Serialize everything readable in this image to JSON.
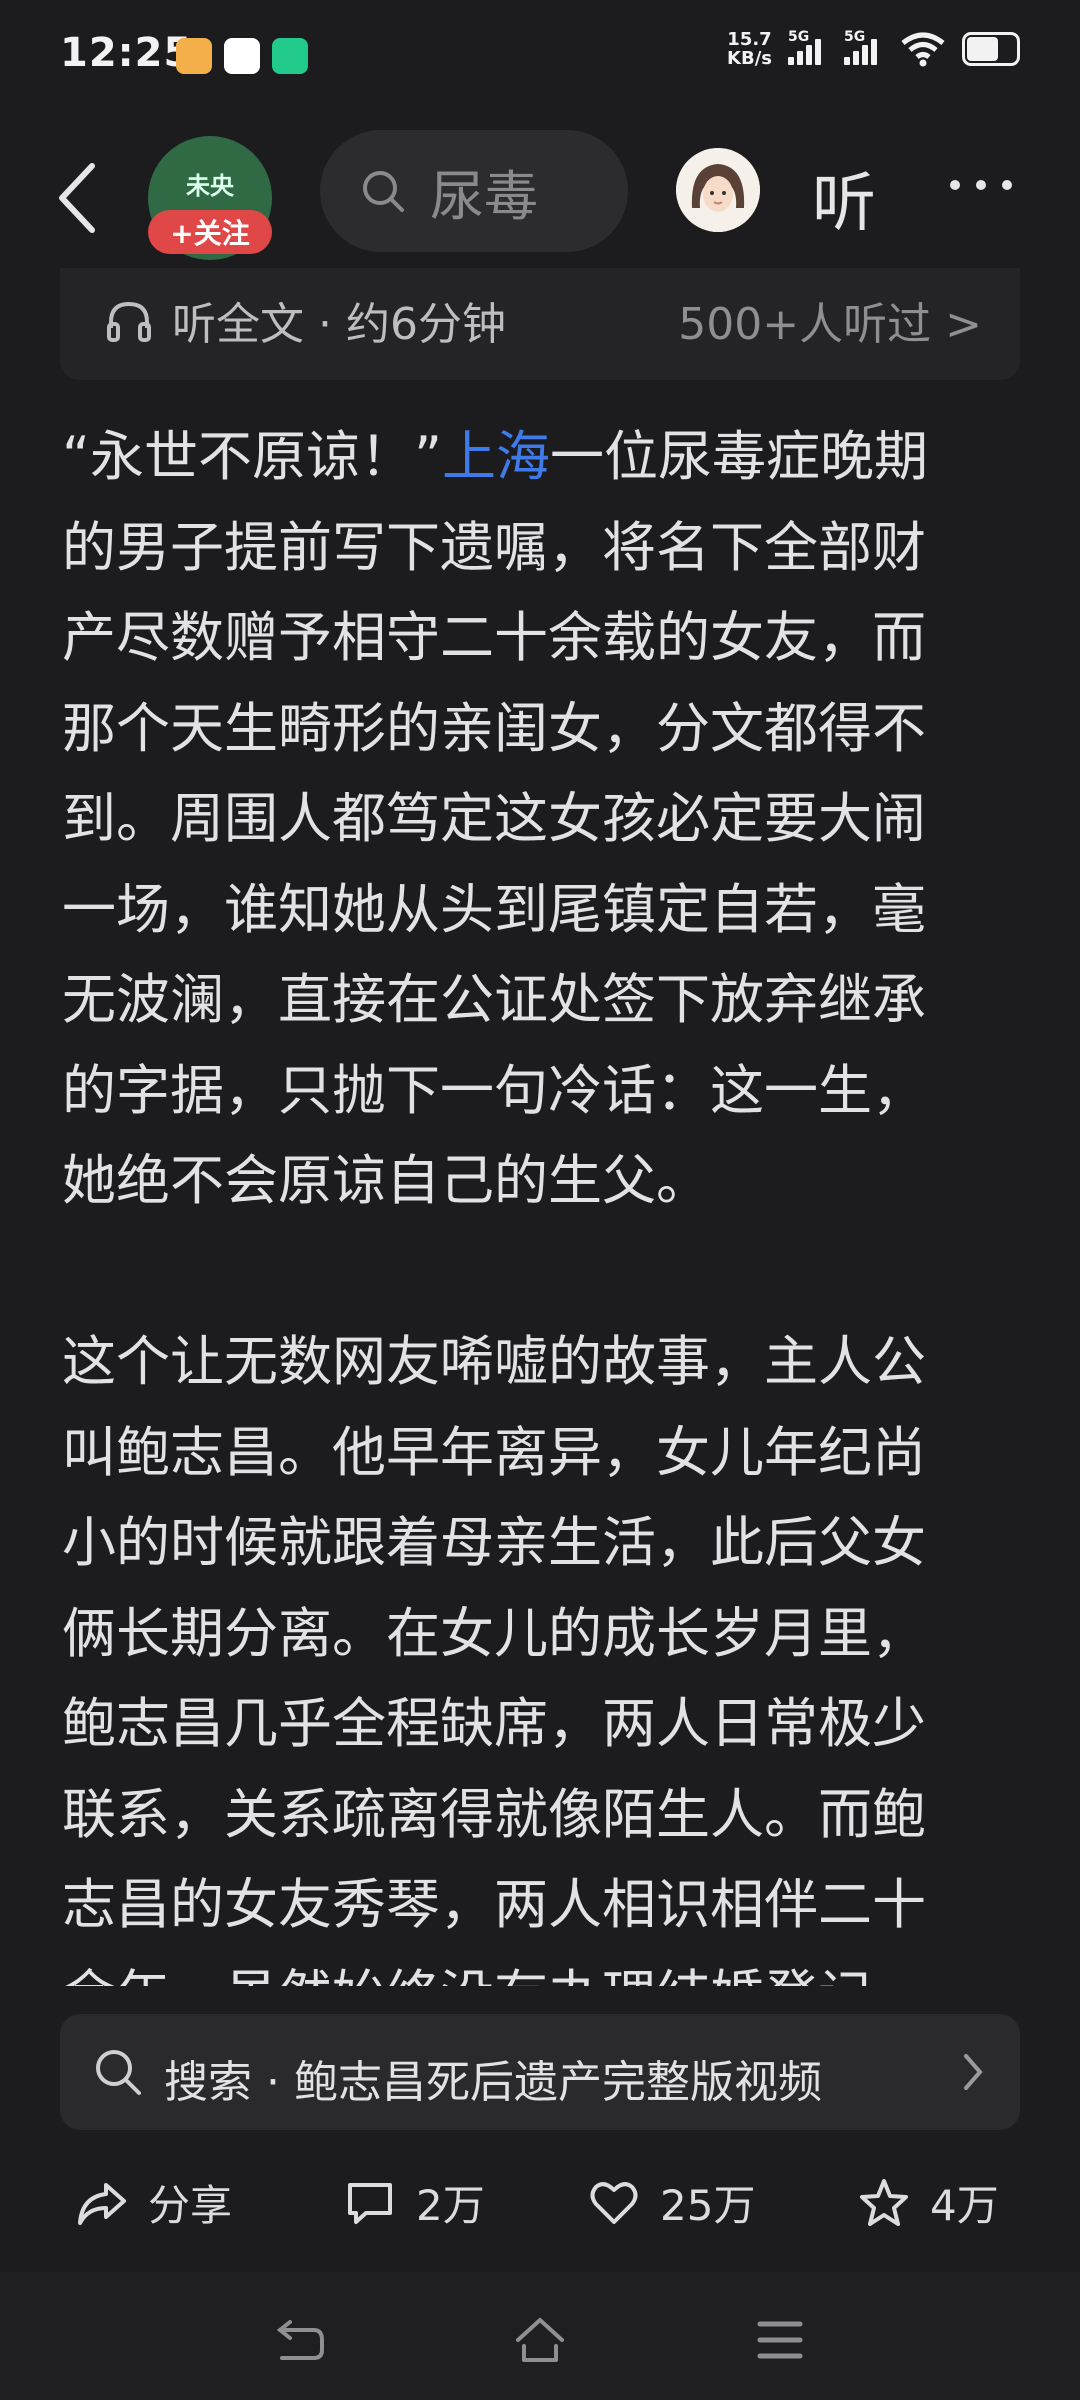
{
  "status_bar": {
    "time": "12:25",
    "net_speed_value": "15.7",
    "net_speed_unit": "KB/s",
    "signal1_label": "5G",
    "signal2_label": "5G",
    "icons": [
      "wifi-icon",
      "battery-icon"
    ]
  },
  "nav": {
    "follow_label": "+关注",
    "avatar_text": "未央",
    "search_placeholder": "尿毒",
    "listen_label": "听"
  },
  "listen_card": {
    "label": "听全文 · 约6分钟",
    "listeners": "500+人听过 >"
  },
  "article": {
    "paragraph1_lines": [
      {
        "pre": "“永世不原谅！”",
        "link": "上海",
        "post": "一位尿毒症晚期"
      },
      "的男子提前写下遗嘱，将名下全部财",
      "产尽数赠予相守二十余载的女友，而",
      "那个天生畸形的亲闺女，分文都得不",
      "到。周围人都笃定这女孩必定要大闹",
      "一场，谁知她从头到尾镇定自若，毫",
      "无波澜，直接在公证处签下放弃继承",
      "的字据，只抛下一句冷话：这一生，",
      "她绝不会原谅自己的生父。"
    ],
    "paragraph2_lines": [
      "这个让无数网友唏嘘的故事，主人公",
      "叫鲍志昌。他早年离异，女儿年纪尚",
      "小的时候就跟着母亲生活，此后父女",
      "俩长期分离。在女儿的成长岁月里，",
      "鲍志昌几乎全程缺席，两人日常极少",
      "联系，关系疏离得就像陌生人。而鲍",
      "志昌的女友秀琴，两人相识相伴二十",
      "余年，虽然始终没有办理结婚登记"
    ]
  },
  "related_search": {
    "text": "搜索 · 鲍志昌死后遗产完整版视频"
  },
  "actions": {
    "share": "分享",
    "comments": "2万",
    "likes": "25万",
    "favorites": "4万"
  },
  "colors": {
    "background": "#1c1c1e",
    "link": "#3f7be8",
    "follow": "#e04848"
  }
}
